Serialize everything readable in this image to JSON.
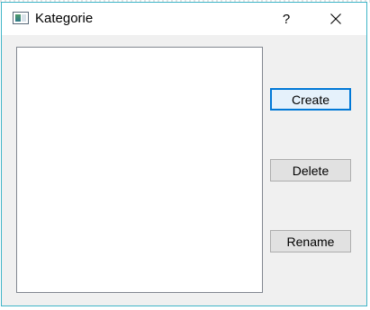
{
  "window": {
    "title": "Kategorie",
    "help_label": "?",
    "icons": {
      "app": "app-window-icon",
      "close": "close-icon"
    }
  },
  "list": {
    "items": []
  },
  "buttons": {
    "create": "Create",
    "delete": "Delete",
    "rename": "Rename"
  },
  "colors": {
    "window_border": "#3fb5c8",
    "default_button_border": "#0078d7"
  }
}
